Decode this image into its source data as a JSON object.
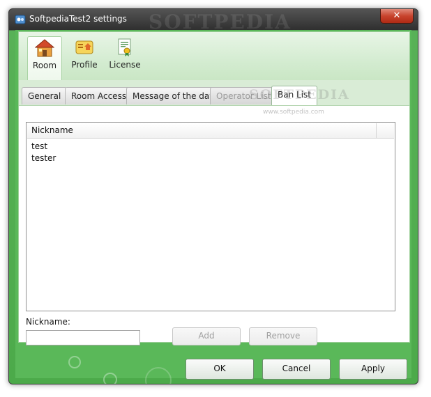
{
  "window": {
    "title": "SoftpediaTest2 settings",
    "close_glyph": "✕",
    "watermark": "SOFTPEDIA"
  },
  "toolbar": {
    "items": [
      {
        "label": "Room",
        "icon": "house-icon",
        "active": true
      },
      {
        "label": "Profile",
        "icon": "profile-card-icon",
        "active": false
      },
      {
        "label": "License",
        "icon": "certificate-icon",
        "active": false
      }
    ]
  },
  "tabs": [
    {
      "label": "General",
      "state": "normal"
    },
    {
      "label": "Room Access",
      "state": "normal"
    },
    {
      "label": "Message of the day",
      "state": "normal"
    },
    {
      "label": "Operator List",
      "state": "disabled"
    },
    {
      "label": "Ban List",
      "state": "active"
    }
  ],
  "watermarks": {
    "tab_overlay": "SOFTPEDIA",
    "url": "www.softpedia.com"
  },
  "ban_list": {
    "column_header": "Nickname",
    "rows": [
      "test",
      "tester"
    ]
  },
  "form": {
    "nickname_label": "Nickname:",
    "nickname_value": "",
    "add_label": "Add",
    "remove_label": "Remove"
  },
  "footer": {
    "ok_label": "OK",
    "cancel_label": "Cancel",
    "apply_label": "Apply"
  },
  "colors": {
    "frame_green": "#5ab859",
    "toolbar_green": "#d4ecd1",
    "close_red": "#c8432d"
  }
}
